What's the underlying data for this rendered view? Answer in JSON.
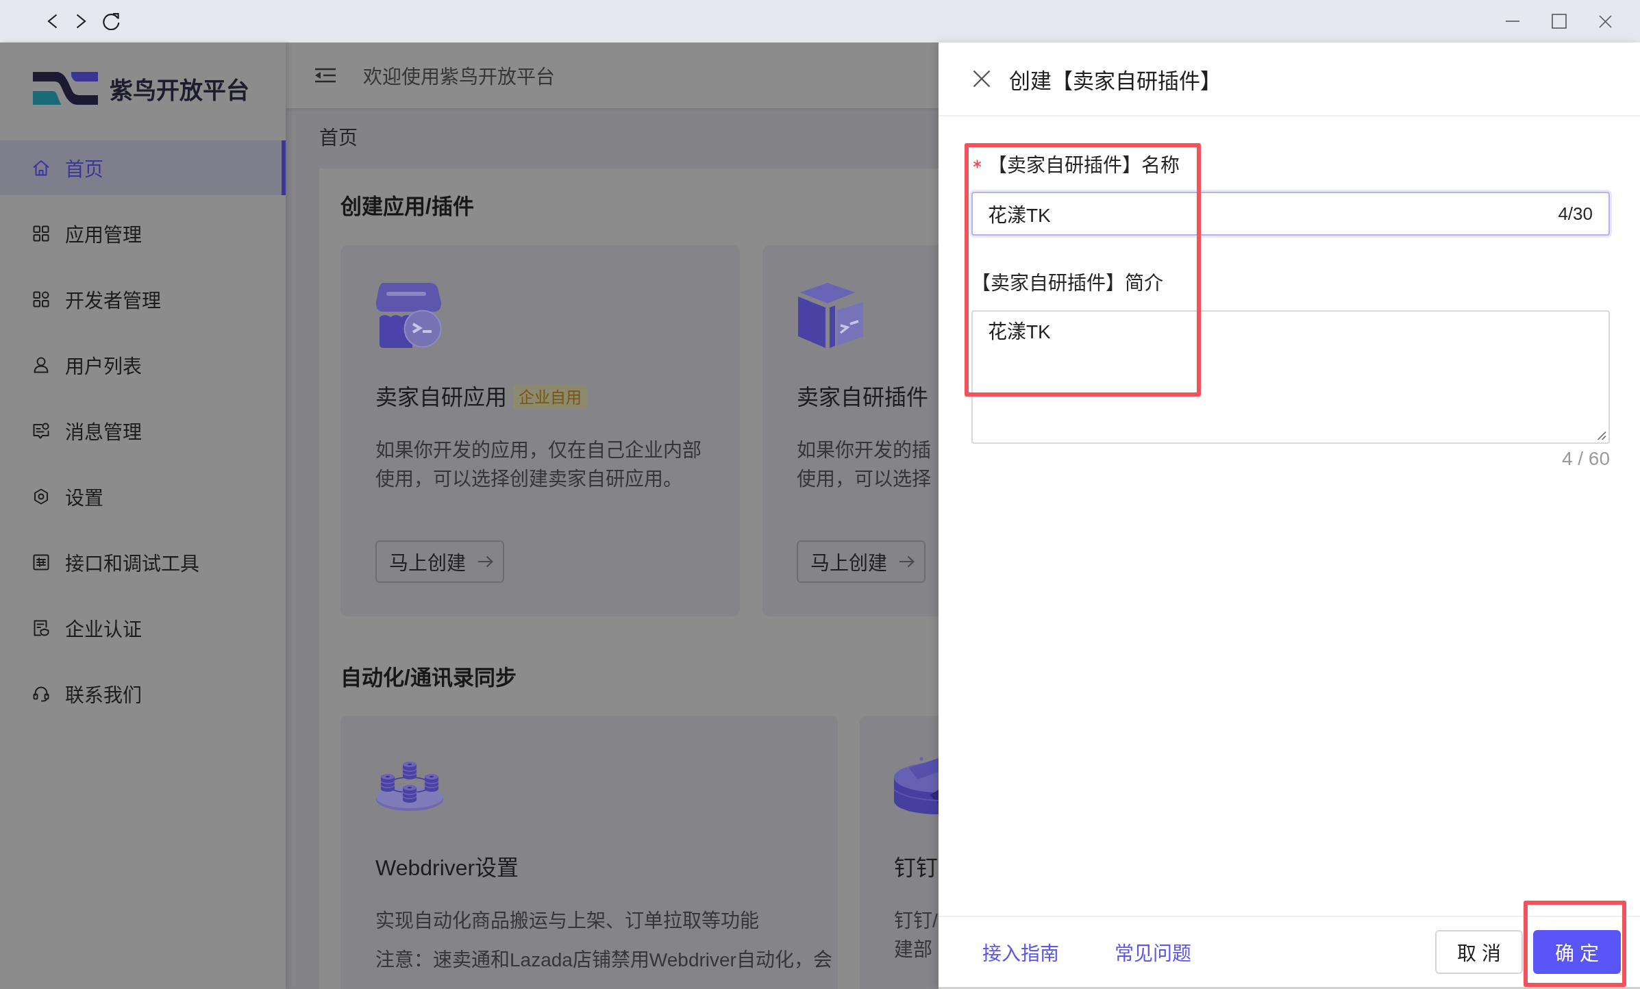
{
  "sidebar": {
    "logo_text": "紫鸟开放平台",
    "items": [
      {
        "label": "首页",
        "selected": true
      },
      {
        "label": "应用管理",
        "selected": false
      },
      {
        "label": "开发者管理",
        "selected": false
      },
      {
        "label": "用户列表",
        "selected": false
      },
      {
        "label": "消息管理",
        "selected": false
      },
      {
        "label": "设置",
        "selected": false
      },
      {
        "label": "接口和调试工具",
        "selected": false
      },
      {
        "label": "企业认证",
        "selected": false
      },
      {
        "label": "联系我们",
        "selected": false
      }
    ]
  },
  "header": {
    "title": "欢迎使用紫鸟开放平台"
  },
  "breadcrumb": "首页",
  "sections": [
    {
      "title": "创建应用/插件",
      "cards": [
        {
          "title": "卖家自研应用",
          "badge": "企业自用",
          "description": [
            "如果你开发的应用，仅在自己企业内部使用，可以选择创建卖家自研应用。"
          ],
          "button": "马上创建"
        },
        {
          "title": "卖家自研插件",
          "description_lines": [
            "如果你开发的插",
            "使用，可以选择"
          ],
          "button": "马上创建"
        }
      ]
    },
    {
      "title": "自动化/通讯录同步",
      "cards": [
        {
          "title": "Webdriver设置",
          "description": [
            "实现自动化商品搬运与上架、订单拉取等功能",
            "注意：速卖通和Lazada店铺禁用Webdriver自动化，会"
          ]
        },
        {
          "title": "钉钉",
          "description_lines": [
            "钉钉/",
            "建部"
          ]
        }
      ]
    }
  ],
  "drawer": {
    "title": "创建【卖家自研插件】",
    "form": {
      "highlighted": true,
      "fields": [
        {
          "kind": "input",
          "label": "【卖家自研插件】名称",
          "required": true,
          "focused": true,
          "value": "花漾TK",
          "counter": "4/30"
        },
        {
          "kind": "textarea",
          "label": "【卖家自研插件】简介",
          "required": false,
          "focused": false,
          "value": "花漾TK",
          "counter": "4 / 60"
        }
      ]
    },
    "footer": {
      "links": [
        "接入指南",
        "常见问题"
      ],
      "buttons": [
        {
          "kind": "default",
          "label": "取 消",
          "highlighted": false
        },
        {
          "kind": "primary",
          "label": "确 定",
          "highlighted": true
        }
      ]
    }
  }
}
